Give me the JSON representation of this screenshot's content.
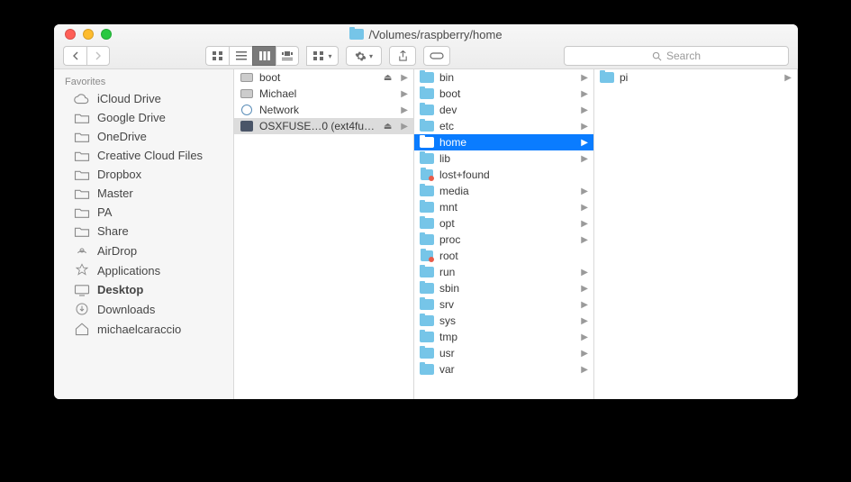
{
  "window": {
    "title_path": "/Volumes/raspberry/home"
  },
  "toolbar": {
    "search_placeholder": "Search"
  },
  "sidebar": {
    "section": "Favorites",
    "items": [
      {
        "icon": "cloud",
        "label": "iCloud Drive"
      },
      {
        "icon": "folder",
        "label": "Google Drive"
      },
      {
        "icon": "folder",
        "label": "OneDrive"
      },
      {
        "icon": "folder",
        "label": "Creative Cloud Files"
      },
      {
        "icon": "folder",
        "label": "Dropbox"
      },
      {
        "icon": "folder",
        "label": "Master"
      },
      {
        "icon": "folder",
        "label": "PA"
      },
      {
        "icon": "folder",
        "label": "Share"
      },
      {
        "icon": "airdrop",
        "label": "AirDrop"
      },
      {
        "icon": "apps",
        "label": "Applications"
      },
      {
        "icon": "desktop",
        "label": "Desktop",
        "bold": true
      },
      {
        "icon": "downloads",
        "label": "Downloads"
      },
      {
        "icon": "home",
        "label": "michaelcaraccio"
      }
    ]
  },
  "columns": [
    {
      "items": [
        {
          "icon": "drive",
          "label": "boot",
          "eject": true,
          "arrow": true,
          "sel": "none"
        },
        {
          "icon": "drive",
          "label": "Michael",
          "eject": false,
          "arrow": true,
          "sel": "none"
        },
        {
          "icon": "globe",
          "label": "Network",
          "eject": false,
          "arrow": true,
          "sel": "none"
        },
        {
          "icon": "fuse",
          "label": "OSXFUSE…0 (ext4fuse)",
          "eject": true,
          "arrow": true,
          "sel": "gray"
        }
      ]
    },
    {
      "items": [
        {
          "icon": "folder",
          "label": "bin",
          "arrow": true,
          "sel": "none"
        },
        {
          "icon": "folder",
          "label": "boot",
          "arrow": true,
          "sel": "none"
        },
        {
          "icon": "folder",
          "label": "dev",
          "arrow": true,
          "sel": "none"
        },
        {
          "icon": "folder",
          "label": "etc",
          "arrow": true,
          "sel": "none"
        },
        {
          "icon": "folder",
          "label": "home",
          "arrow": true,
          "sel": "blue"
        },
        {
          "icon": "folder",
          "label": "lib",
          "arrow": true,
          "sel": "none"
        },
        {
          "icon": "locked",
          "label": "lost+found",
          "arrow": false,
          "sel": "none"
        },
        {
          "icon": "folder",
          "label": "media",
          "arrow": true,
          "sel": "none"
        },
        {
          "icon": "folder",
          "label": "mnt",
          "arrow": true,
          "sel": "none"
        },
        {
          "icon": "folder",
          "label": "opt",
          "arrow": true,
          "sel": "none"
        },
        {
          "icon": "folder",
          "label": "proc",
          "arrow": true,
          "sel": "none"
        },
        {
          "icon": "locked",
          "label": "root",
          "arrow": false,
          "sel": "none"
        },
        {
          "icon": "folder",
          "label": "run",
          "arrow": true,
          "sel": "none"
        },
        {
          "icon": "folder",
          "label": "sbin",
          "arrow": true,
          "sel": "none"
        },
        {
          "icon": "folder",
          "label": "srv",
          "arrow": true,
          "sel": "none"
        },
        {
          "icon": "folder",
          "label": "sys",
          "arrow": true,
          "sel": "none"
        },
        {
          "icon": "folder",
          "label": "tmp",
          "arrow": true,
          "sel": "none"
        },
        {
          "icon": "folder",
          "label": "usr",
          "arrow": true,
          "sel": "none"
        },
        {
          "icon": "folder",
          "label": "var",
          "arrow": true,
          "sel": "none"
        }
      ]
    },
    {
      "items": [
        {
          "icon": "folder",
          "label": "pi",
          "arrow": true,
          "sel": "none"
        }
      ]
    }
  ]
}
